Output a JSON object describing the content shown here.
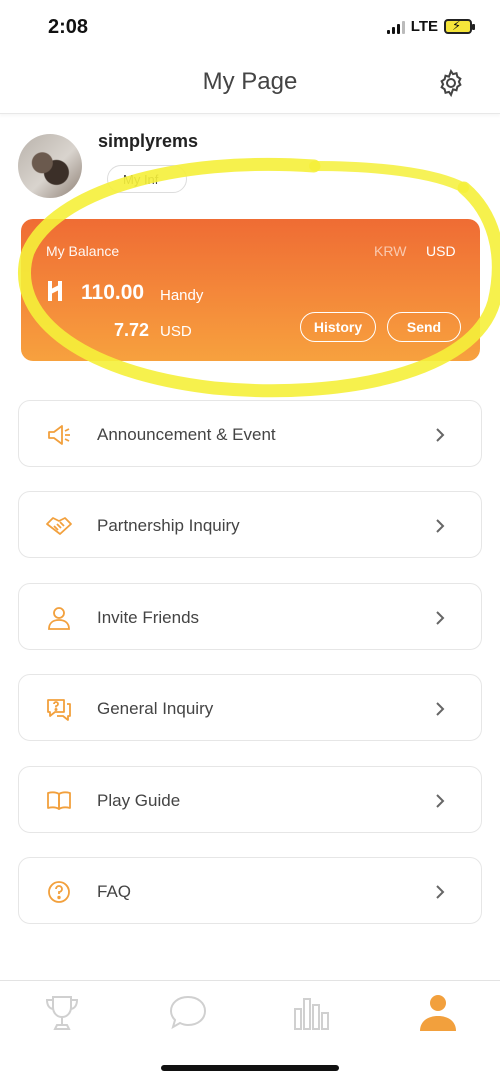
{
  "status_bar": {
    "time": "2:08",
    "network": "LTE"
  },
  "header": {
    "title": "My Page",
    "settings_icon": "gear-icon"
  },
  "profile": {
    "username": "simplyrems",
    "info_button_label": "My Inf"
  },
  "balance": {
    "title": "My Balance",
    "currency_options": [
      "KRW",
      "USD"
    ],
    "selected_currency": "USD",
    "token_amount": "110.00",
    "token_unit": "Handy",
    "fiat_amount": "7.72",
    "fiat_unit": "USD",
    "history_label": "History",
    "send_label": "Send"
  },
  "menu": {
    "items": [
      {
        "label": "Announcement & Event",
        "icon": "megaphone-icon"
      },
      {
        "label": "Partnership Inquiry",
        "icon": "handshake-icon"
      },
      {
        "label": "Invite Friends",
        "icon": "person-icon"
      },
      {
        "label": "General Inquiry",
        "icon": "question-chat-icon"
      },
      {
        "label": "Play Guide",
        "icon": "book-icon"
      },
      {
        "label": "FAQ",
        "icon": "question-circle-icon"
      }
    ]
  },
  "tabbar": {
    "tabs": [
      {
        "icon": "trophy-icon",
        "active": false
      },
      {
        "icon": "chat-bubble-icon",
        "active": false
      },
      {
        "icon": "bar-chart-icon",
        "active": false
      },
      {
        "icon": "person-icon",
        "active": true
      }
    ]
  },
  "colors": {
    "accent": "#f2a03d",
    "card_gradient_top": "#ef6c34",
    "card_gradient_bottom": "#f7a13e",
    "highlight": "#f5f03a",
    "tab_inactive": "#d0d0d0"
  }
}
